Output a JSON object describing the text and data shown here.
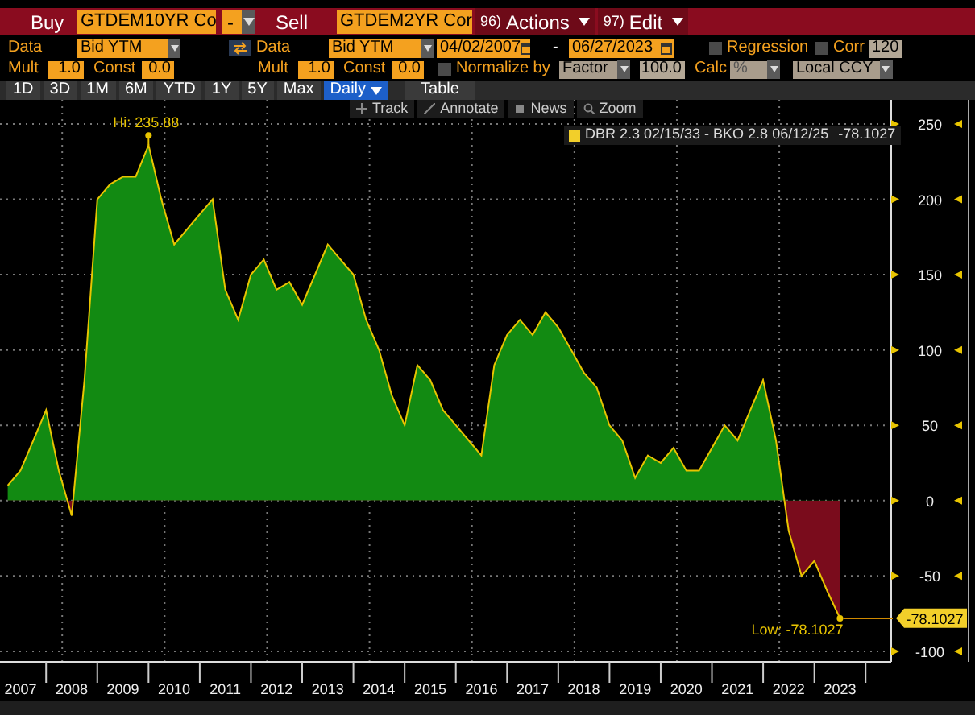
{
  "toolbar": {
    "buy_label": "Buy",
    "buy_security": "GTDEM10YR Co",
    "operator": "-",
    "sell_label": "Sell",
    "sell_security": "GTDEM2YR Cor",
    "menus": [
      {
        "number": "96)",
        "label": "Actions"
      },
      {
        "number": "97)",
        "label": "Edit"
      }
    ]
  },
  "data_row": {
    "buy": {
      "label": "Data",
      "field": "Bid YTM"
    },
    "sell": {
      "label": "Data",
      "field": "Bid YTM"
    },
    "start_date": "04/02/2007",
    "date_separator": "-",
    "end_date": "06/27/2023",
    "regression": {
      "label": "Regression",
      "checked": false
    },
    "corr": {
      "label": "Corr",
      "checked": false,
      "value": "120"
    }
  },
  "mult_row": {
    "buy": {
      "mult_label": "Mult",
      "mult": "1.0",
      "const_label": "Const",
      "const": "0.0"
    },
    "sell": {
      "mult_label": "Mult",
      "mult": "1.0",
      "const_label": "Const",
      "const": "0.0"
    },
    "normalize": {
      "label": "Normalize by",
      "checked": false,
      "method": "Factor",
      "factor": "100.0"
    },
    "calc_label": "Calc",
    "calc": "%",
    "currency": "Local CCY"
  },
  "periods": [
    {
      "label": "1D",
      "selected": false
    },
    {
      "label": "3D",
      "selected": false
    },
    {
      "label": "1M",
      "selected": false
    },
    {
      "label": "6M",
      "selected": false
    },
    {
      "label": "YTD",
      "selected": false
    },
    {
      "label": "1Y",
      "selected": false
    },
    {
      "label": "5Y",
      "selected": false
    },
    {
      "label": "Max",
      "selected": false
    },
    {
      "label": "Daily",
      "selected": true,
      "dropdown": true
    },
    {
      "label": "Table",
      "selected": false
    }
  ],
  "chart_tools": [
    {
      "label": "Track"
    },
    {
      "label": "Annotate"
    },
    {
      "label": "News"
    },
    {
      "label": "Zoom"
    }
  ],
  "chart": {
    "legend_value": "-78.1027",
    "last_value_label": "-78.1027",
    "chart_data": {
      "type": "area",
      "grid": true,
      "xlim": [
        2007.1,
        2024.5
      ],
      "ylim": [
        -107,
        266
      ],
      "x": [
        2007.25,
        2007.5,
        2007.75,
        2008.0,
        2008.25,
        2008.5,
        2008.75,
        2009.0,
        2009.25,
        2009.5,
        2009.75,
        2010.0,
        2010.25,
        2010.5,
        2010.75,
        2011.0,
        2011.25,
        2011.5,
        2011.75,
        2012.0,
        2012.25,
        2012.5,
        2012.75,
        2013.0,
        2013.25,
        2013.5,
        2013.75,
        2014.0,
        2014.25,
        2014.5,
        2014.75,
        2015.0,
        2015.25,
        2015.5,
        2015.75,
        2016.0,
        2016.25,
        2016.5,
        2016.75,
        2017.0,
        2017.25,
        2017.5,
        2017.75,
        2018.0,
        2018.25,
        2018.5,
        2018.75,
        2019.0,
        2019.25,
        2019.5,
        2019.75,
        2020.0,
        2020.25,
        2020.5,
        2020.75,
        2021.0,
        2021.25,
        2021.5,
        2021.75,
        2022.0,
        2022.25,
        2022.5,
        2022.75,
        2023.0,
        2023.25,
        2023.5
      ],
      "series": [
        {
          "name": "DBR 2.3 02/15/33 - BKO 2.8 06/12/25",
          "color": "#128a12",
          "values": [
            10,
            20,
            40,
            60,
            20,
            -10,
            80,
            200,
            210,
            215,
            215,
            236,
            200,
            170,
            180,
            190,
            200,
            140,
            120,
            150,
            160,
            140,
            145,
            130,
            150,
            170,
            160,
            150,
            120,
            100,
            70,
            50,
            90,
            80,
            60,
            50,
            40,
            30,
            90,
            110,
            120,
            110,
            125,
            115,
            100,
            85,
            75,
            50,
            40,
            15,
            30,
            25,
            35,
            20,
            20,
            35,
            50,
            40,
            60,
            80,
            40,
            -20,
            -50,
            -40,
            -60,
            -78
          ]
        }
      ],
      "xticks": [
        {
          "value": 2007.5,
          "label": "2007"
        },
        {
          "value": 2008.5,
          "label": "2008"
        },
        {
          "value": 2009.5,
          "label": "2009"
        },
        {
          "value": 2010.5,
          "label": "2010"
        },
        {
          "value": 2011.5,
          "label": "2011"
        },
        {
          "value": 2012.5,
          "label": "2012"
        },
        {
          "value": 2013.5,
          "label": "2013"
        },
        {
          "value": 2014.5,
          "label": "2014"
        },
        {
          "value": 2015.5,
          "label": "2015"
        },
        {
          "value": 2016.5,
          "label": "2016"
        },
        {
          "value": 2017.5,
          "label": "2017"
        },
        {
          "value": 2018.5,
          "label": "2018"
        },
        {
          "value": 2019.5,
          "label": "2019"
        },
        {
          "value": 2020.5,
          "label": "2020"
        },
        {
          "value": 2021.5,
          "label": "2021"
        },
        {
          "value": 2022.5,
          "label": "2022"
        },
        {
          "value": 2023.5,
          "label": "2023"
        }
      ],
      "yticks": [
        -100,
        -50,
        0,
        50,
        100,
        150,
        200,
        250
      ],
      "annotations": [
        {
          "text": "Hi: 235.88",
          "x": 2010.0,
          "y": 235.88
        },
        {
          "text": "Low: -78.1027",
          "x": 2023.5,
          "y": -78.1027
        }
      ]
    }
  }
}
